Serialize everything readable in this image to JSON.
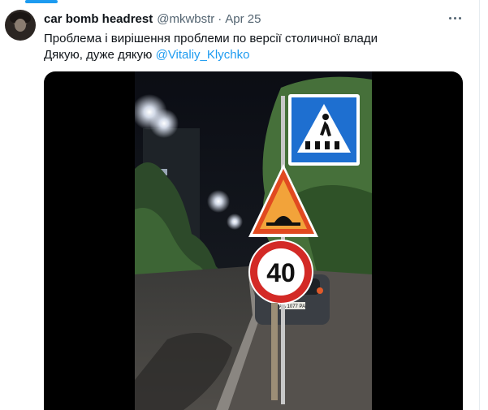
{
  "tweet": {
    "author_name": "car bomb headrest",
    "author_handle": "@mkwbstr",
    "separator": "·",
    "date": "Apr 25",
    "text_line1": "Проблема і вирішення проблеми по версії столичної влади",
    "text_line2_prefix": "Дякую, дуже дякую ",
    "mention": "@Vitaliy_Klychko"
  },
  "media": {
    "speed_limit_sign": "40",
    "car_plate": "АА 1077 РА"
  },
  "icons": [
    "more-options-icon",
    "pedestrian-crossing-sign-icon",
    "speed-bump-warning-sign-icon"
  ],
  "colors": {
    "link": "#1d9bf0",
    "secondary_text": "#536471",
    "primary_text": "#0f1419"
  }
}
